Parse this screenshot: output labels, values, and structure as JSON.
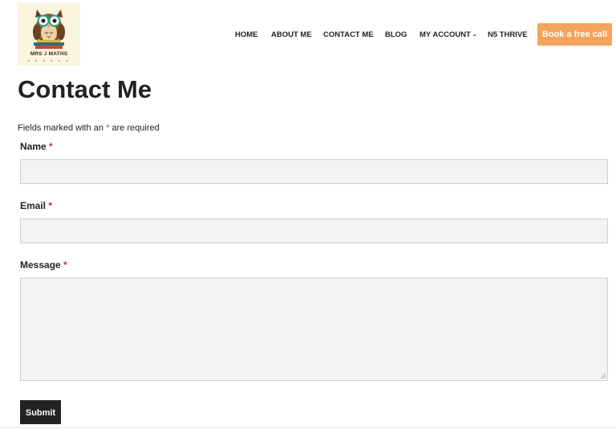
{
  "brand": {
    "logo_text": "MRS J MATHS",
    "logo_dots": "● ● ● ● ● ●",
    "owl_color": "#8b5a2b",
    "glasses_color": "#1f9a8a"
  },
  "nav": {
    "items": [
      {
        "label": "HOME",
        "dropdown": false
      },
      {
        "label": "ABOUT ME",
        "dropdown": false
      },
      {
        "label": "CONTACT ME",
        "dropdown": false
      },
      {
        "label": "BLOG",
        "dropdown": false
      },
      {
        "label": "MY ACCOUNT",
        "dropdown": true
      },
      {
        "label": "N5 THRIVE",
        "dropdown": false
      }
    ],
    "dropdown_glyph": "⌄",
    "cta_label": "Book a free call",
    "cta_color": "#f5a35a"
  },
  "page": {
    "title": "Contact Me",
    "required_note_prefix": "Fields marked with an",
    "required_star": "*",
    "required_note_suffix": "are required"
  },
  "form": {
    "fields": [
      {
        "label": "Name",
        "required": true,
        "value": ""
      },
      {
        "label": "Email",
        "required": true,
        "value": ""
      },
      {
        "label": "Message",
        "required": true,
        "value": ""
      }
    ],
    "submit_label": "Submit"
  },
  "colors": {
    "required_star": "#c9322b",
    "submit_bg": "#222222",
    "input_bg": "#f3f3f3"
  }
}
